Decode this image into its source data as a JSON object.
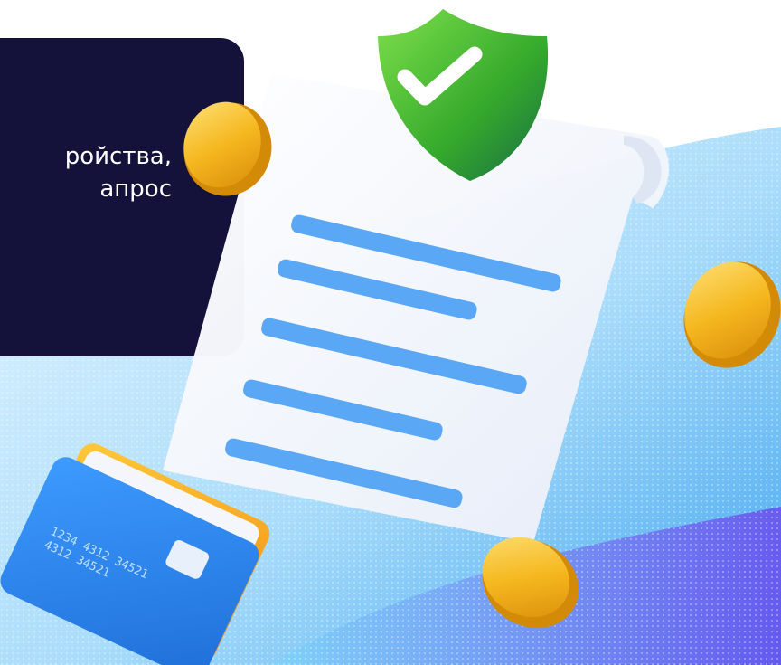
{
  "promo": {
    "line1": "ройства,",
    "line2": "апрос"
  },
  "bank_card": {
    "number_line1": "1234  4312  34521",
    "number_line2": "4312  34521"
  },
  "colors": {
    "dark_panel": "#14123a",
    "accent_blue": "#5aa7f5",
    "shield_green": "#3cb233",
    "coin_gold": "#f5b820",
    "card_blue": "#2f8df0",
    "card_orange": "#f7a51b"
  },
  "icons": [
    "shield-check-icon",
    "coin-icon",
    "receipt-icon",
    "credit-card-icon"
  ]
}
